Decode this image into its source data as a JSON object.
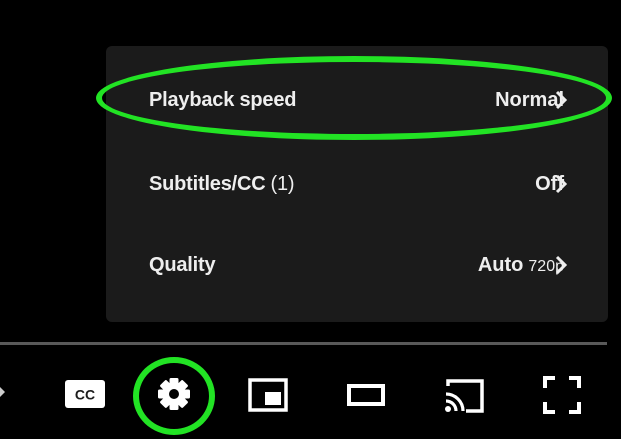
{
  "settings_menu": {
    "items": [
      {
        "label": "Playback speed",
        "count": "",
        "value": "Normal",
        "value_sub": ""
      },
      {
        "label": "Subtitles/CC",
        "count": "(1)",
        "value": "Off",
        "value_sub": ""
      },
      {
        "label": "Quality",
        "count": "",
        "value": "Auto",
        "value_sub": "720p"
      }
    ]
  },
  "controls": {
    "icons": [
      "subtitles-cc-icon",
      "settings-gear-icon",
      "miniplayer-icon",
      "theater-mode-icon",
      "cast-icon",
      "fullscreen-icon"
    ],
    "cc_label": "CC"
  },
  "annotations": {
    "highlight_color": "#22e324"
  },
  "colors": {
    "menu_background": "#1c1c1c",
    "text": "#eeeeee",
    "player_background": "#000000"
  }
}
